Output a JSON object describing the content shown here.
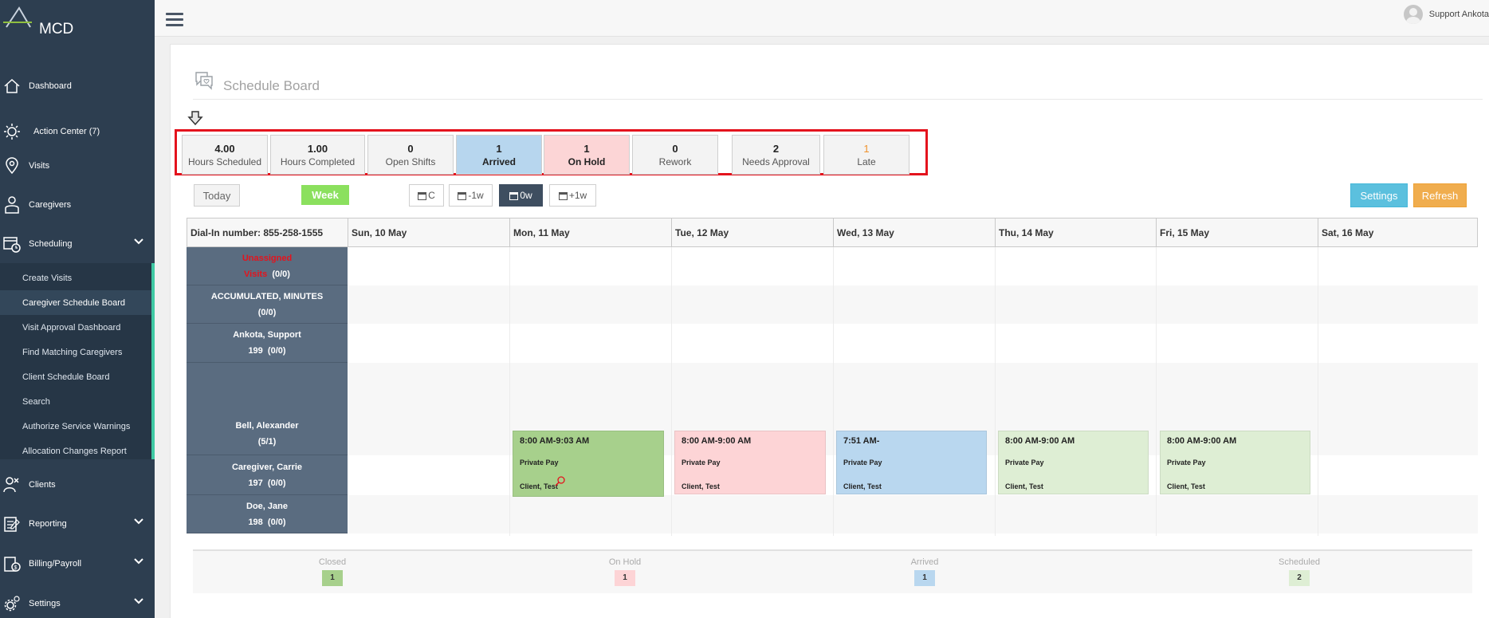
{
  "app": {
    "name": "MCD"
  },
  "nav": {
    "dashboard": "Dashboard",
    "action_center": "Action Center (7)",
    "visits": "Visits",
    "caregivers": "Caregivers",
    "scheduling": "Scheduling",
    "clients": "Clients",
    "reporting": "Reporting",
    "billing": "Billing/Payroll",
    "settings": "Settings",
    "scheduling_sub": [
      "Create Visits",
      "Caregiver Schedule Board",
      "Visit Approval Dashboard",
      "Find Matching Caregivers",
      "Client Schedule Board",
      "Search",
      "Authorize Service Warnings",
      "Allocation Changes Report"
    ]
  },
  "user": {
    "name": "Support Ankota"
  },
  "page": {
    "title": "Schedule Board"
  },
  "stats": [
    {
      "value": "4.00",
      "label": "Hours Scheduled"
    },
    {
      "value": "1.00",
      "label": "Hours Completed"
    },
    {
      "value": "0",
      "label": "Open Shifts"
    },
    {
      "value": "1",
      "label": "Arrived"
    },
    {
      "value": "1",
      "label": "On Hold"
    },
    {
      "value": "0",
      "label": "Rework"
    },
    {
      "value": "2",
      "label": "Needs Approval"
    },
    {
      "value": "1",
      "label": "Late"
    }
  ],
  "toolbar": {
    "today": "Today",
    "week": "Week",
    "current": "C",
    "minus_week": "-1w",
    "zero_week": "0w",
    "plus_week": "+1w",
    "settings": "Settings",
    "refresh": "Refresh"
  },
  "grid": {
    "dial_in": "Dial-In number: 855-258-1555",
    "days": [
      "Sun, 10 May",
      "Mon, 11 May",
      "Tue, 12 May",
      "Wed, 13 May",
      "Thu, 14 May",
      "Fri, 15 May",
      "Sat, 16 May"
    ],
    "rows": [
      {
        "line1": "Unassigned",
        "line2": "Visits",
        "count": "(0/0)"
      },
      {
        "line1": "ACCUMULATED, MINUTES",
        "count": "(0/0)"
      },
      {
        "line1": "Ankota, Support",
        "id": "199",
        "count": "(0/0)"
      },
      {
        "line1": "Bell, Alexander",
        "count": "(5/1)"
      },
      {
        "line1": "Caregiver, Carrie",
        "id": "197",
        "count": "(0/0)"
      },
      {
        "line1": "Doe, Jane",
        "id": "198",
        "count": "(0/0)"
      }
    ],
    "visits": [
      {
        "time": "8:00 AM-9:03 AM",
        "pay": "Private Pay",
        "client": "Client, Test"
      },
      {
        "time": "8:00 AM-9:00 AM",
        "pay": "Private Pay",
        "client": "Client, Test"
      },
      {
        "time": "7:51 AM-",
        "pay": "Private Pay",
        "client": "Client, Test"
      },
      {
        "time": "8:00 AM-9:00 AM",
        "pay": "Private Pay",
        "client": "Client, Test"
      },
      {
        "time": "8:00 AM-9:00 AM",
        "pay": "Private Pay",
        "client": "Client, Test"
      }
    ]
  },
  "legend": [
    {
      "label": "Closed",
      "value": "1",
      "color": "#a7d08c"
    },
    {
      "label": "On Hold",
      "value": "1",
      "color": "#fdd4d6"
    },
    {
      "label": "Arrived",
      "value": "1",
      "color": "#b9d7ef"
    },
    {
      "label": "Scheduled",
      "value": "2",
      "color": "#deeed4"
    }
  ]
}
